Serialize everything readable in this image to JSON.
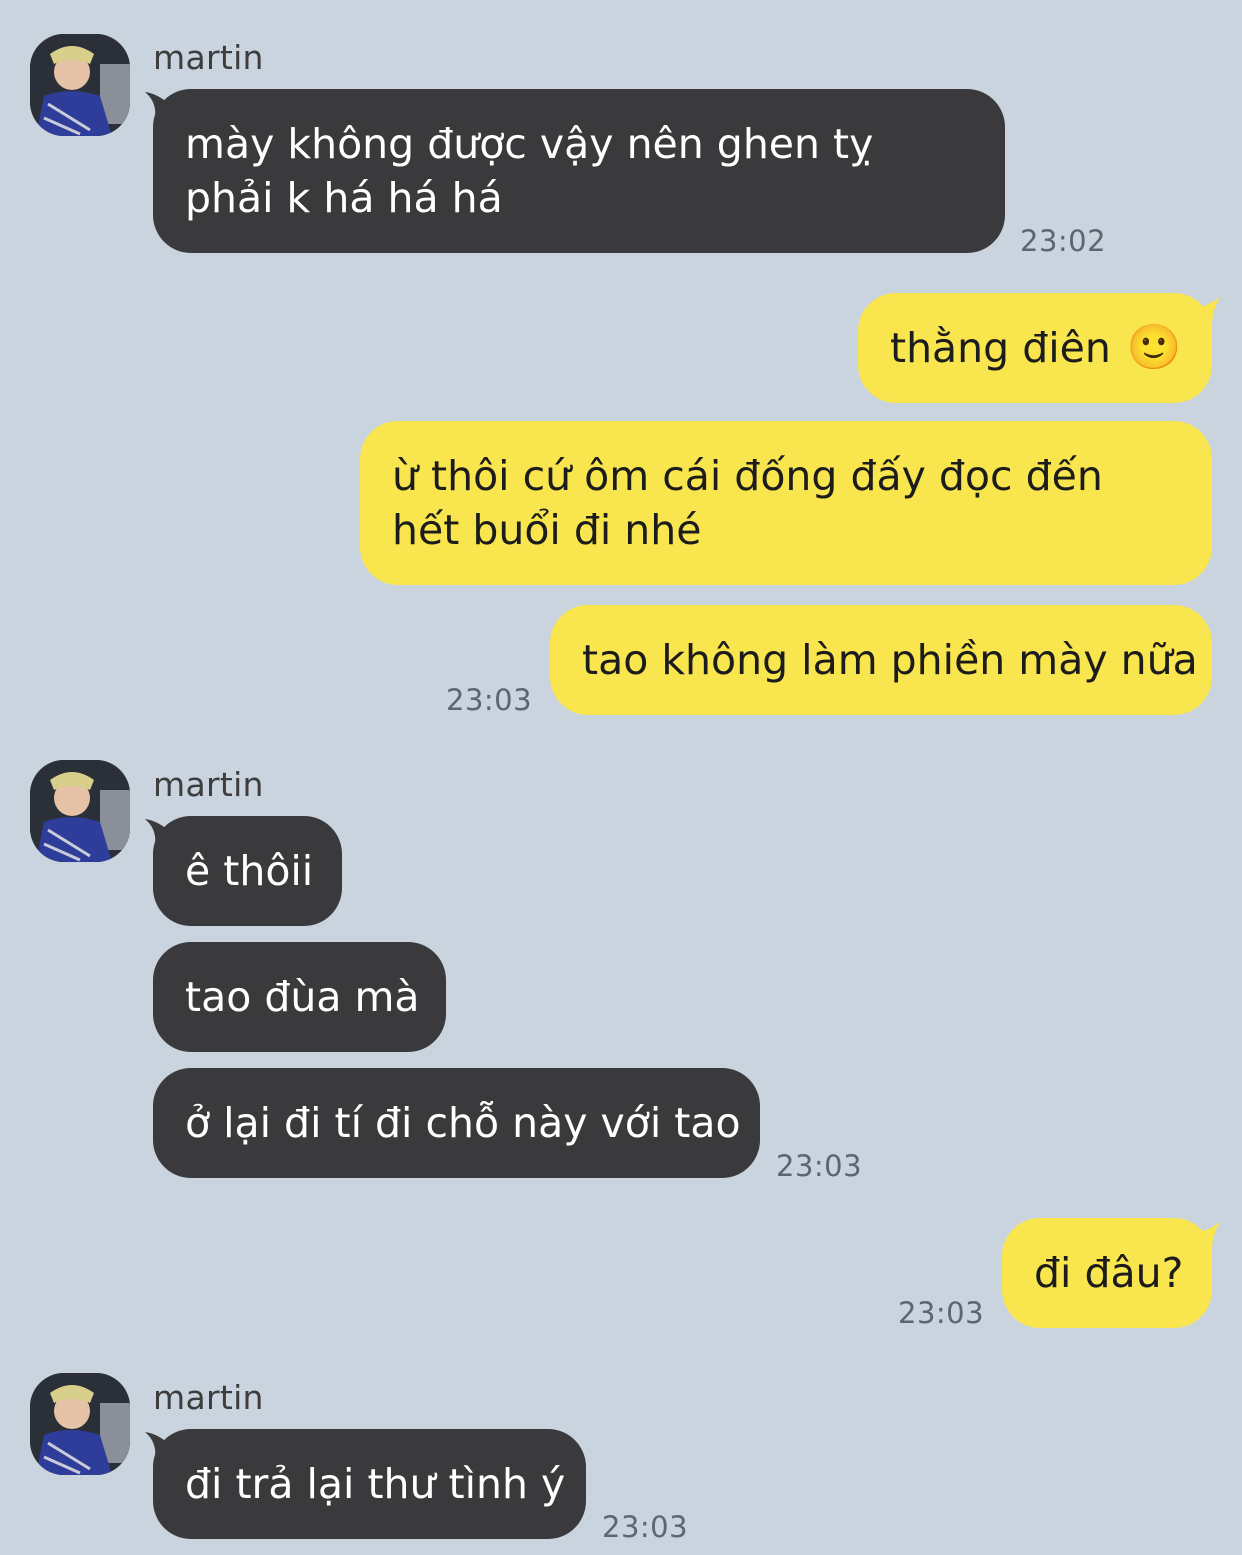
{
  "contact": {
    "name": "martin"
  },
  "colors": {
    "background": "#c9d4df",
    "incoming": "#3a3a3c",
    "outgoing": "#f9e54e"
  },
  "messages": [
    {
      "from": "martin",
      "text": "mày không được vậy nên ghen tỵ phải k há há há",
      "time": "23:02"
    },
    {
      "from": "me",
      "text": "thằng điên",
      "emoji": "🙂"
    },
    {
      "from": "me",
      "text": "ừ thôi cứ ôm cái đống đấy đọc đến hết buổi đi nhé"
    },
    {
      "from": "me",
      "text": "tao không làm phiền mày nữa",
      "time": "23:03"
    },
    {
      "from": "martin",
      "text": "ê thôii"
    },
    {
      "from": "martin",
      "text": "tao đùa mà"
    },
    {
      "from": "martin",
      "text": "ở lại đi tí đi chỗ này với tao",
      "time": "23:03"
    },
    {
      "from": "me",
      "text": "đi đâu?",
      "time": "23:03"
    },
    {
      "from": "martin",
      "text": "đi trả lại thư tình ý",
      "time": "23:03"
    }
  ]
}
